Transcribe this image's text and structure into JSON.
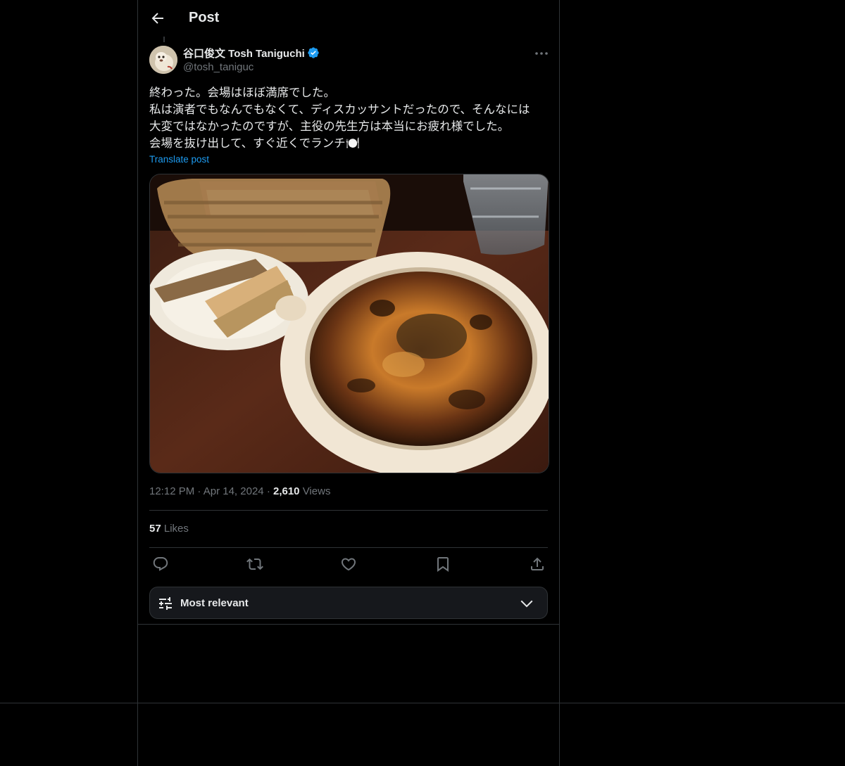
{
  "header": {
    "title": "Post"
  },
  "post": {
    "author_name": "谷口俊文 Tosh Taniguchi",
    "author_handle": "@tosh_taniguc",
    "text": "終わった。会場はほぼ満席でした。\n私は演者でもなんでもなくて、ディスカッサントだったので、そんなには\n大変ではなかったのですが、主役の先生方は本当にお疲れ様でした。\n会場を抜け出して、すぐ近くでランチ🍽️",
    "translate_label": "Translate post",
    "time": "12:12 PM",
    "date": "Apr 14, 2024",
    "views_count": "2,610",
    "views_label": "Views",
    "likes_count": "57",
    "likes_label": "Likes"
  },
  "sort": {
    "label": "Most relevant"
  },
  "colors": {
    "accent": "#1d9bf0",
    "muted": "#71767b",
    "border": "#2f3336"
  }
}
